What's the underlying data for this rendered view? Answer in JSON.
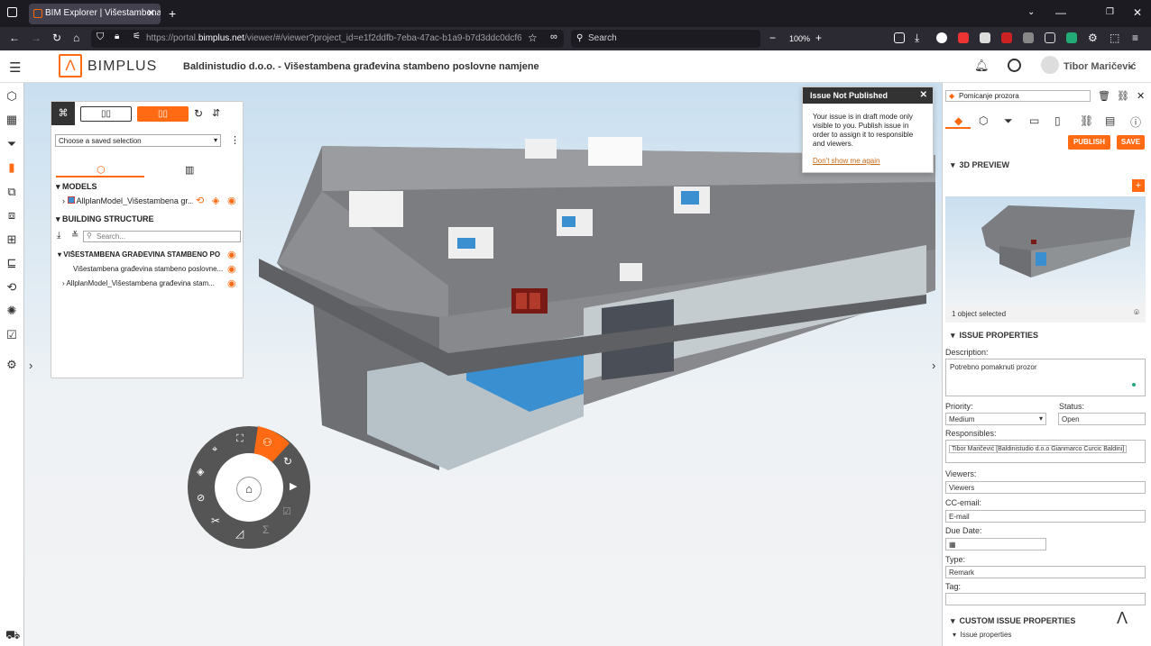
{
  "browser": {
    "tab_title": "BIM Explorer | Višestambena g",
    "url_prefix": "https://portal.",
    "url_domain": "bimplus.net",
    "url_rest": "/viewer/#/viewer?project_id=e1f2ddfb-7eba-47ac-b1a9-b7d3ddc0dcf6&team",
    "search_placeholder": "Search",
    "zoom": "100%"
  },
  "header": {
    "brand": "BIMPLUS",
    "project": "Baldinistudio d.o.o.  -  Višestambena građevina stambeno poslovne namjene",
    "user": "Tibor Maričević"
  },
  "left_panel": {
    "saved_selection": "Choose a saved selection",
    "models_title": "MODELS",
    "model_name": "AllplanModel_Višestambena gr...",
    "building_title": "BUILDING STRUCTURE",
    "search_placeholder": "Search...",
    "tree": [
      "VIŠESTAMBENA GRAĐEVINA STAMBENO PO...",
      "Višestambena građevina stambeno poslovne...",
      "AllplanModel_Višestambena građevina stam..."
    ]
  },
  "notification": {
    "title": "Issue Not Published",
    "body": "Your issue is in draft mode only visible to you. Publish issue in order to assign it to responsible and viewers.",
    "link": "Don't show me again"
  },
  "issue": {
    "title_value": "Pomicanje prozora",
    "publish": "PUBLISH",
    "save": "SAVE",
    "preview_title": "3D PREVIEW",
    "selected": "1 object selected",
    "props_title": "ISSUE PROPERTIES",
    "description_label": "Description:",
    "description": "Potrebno pomaknuti prozor",
    "priority_label": "Priority:",
    "priority": "Medium",
    "status_label": "Status:",
    "status": "Open",
    "responsibles_label": "Responsibles:",
    "responsible": "Tibor Maričević [Baldinistudio d.o.o Gianmarco Curcic Baldini]",
    "viewers_label": "Viewers:",
    "viewers_placeholder": "Viewers",
    "cc_label": "CC-email:",
    "cc_placeholder": "E-mail",
    "due_label": "Due Date:",
    "type_label": "Type:",
    "type": "Remark",
    "tag_label": "Tag:",
    "custom_title": "CUSTOM ISSUE PROPERTIES",
    "custom_item": "Issue properties"
  },
  "colors": {
    "accent": "#ff6a13",
    "dark": "#333333"
  }
}
